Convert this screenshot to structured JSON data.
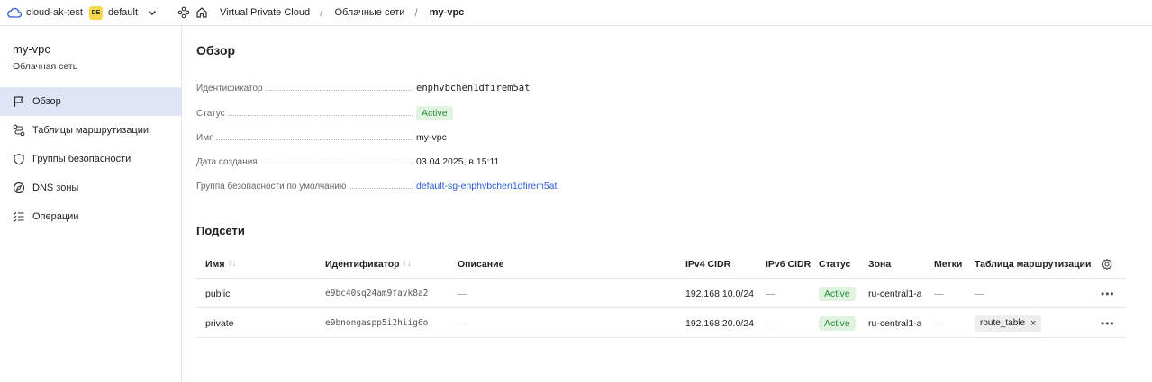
{
  "topbar": {
    "cloud_name": "cloud-ak-test",
    "folder_badge": "DE",
    "folder_name": "default",
    "breadcrumbs": [
      "Virtual Private Cloud",
      "Облачные сети",
      "my-vpc"
    ],
    "separator": "/"
  },
  "sidebar": {
    "title": "my-vpc",
    "subtitle": "Облачная сеть",
    "items": [
      {
        "label": "Обзор",
        "icon": "flag-icon",
        "active": true
      },
      {
        "label": "Таблицы маршрутизации",
        "icon": "route-icon"
      },
      {
        "label": "Группы безопасности",
        "icon": "shield-icon"
      },
      {
        "label": "DNS зоны",
        "icon": "compass-icon"
      },
      {
        "label": "Операции",
        "icon": "list-check-icon"
      }
    ]
  },
  "overview": {
    "title": "Обзор",
    "props": [
      {
        "label": "Идентификатор",
        "value": "enphvbchen1dfirem5at"
      },
      {
        "label": "Статус",
        "value": "Active"
      },
      {
        "label": "Имя",
        "value": "my-vpc"
      },
      {
        "label": "Дата создания",
        "value": "03.04.2025, в 15:11"
      },
      {
        "label": "Группа безопасности по умолчанию",
        "value": "default-sg-enphvbchen1dfirem5at"
      }
    ]
  },
  "subnets": {
    "title": "Подсети",
    "columns": [
      "Имя",
      "Идентификатор",
      "Описание",
      "IPv4 CIDR",
      "IPv6 CIDR",
      "Статус",
      "Зона",
      "Метки",
      "Таблица маршрутизации"
    ],
    "sort_glyph": "↑↓",
    "rows": [
      {
        "name": "public",
        "id": "e9bc40sq24am9favk8a2",
        "description": "—",
        "ipv4": "192.168.10.0/24",
        "ipv6": "—",
        "status": "Active",
        "zone": "ru-central1-a",
        "labels": "—",
        "route_table": "—"
      },
      {
        "name": "private",
        "id": "e9bnongaspp5i2hiig6o",
        "description": "—",
        "ipv4": "192.168.20.0/24",
        "ipv6": "—",
        "status": "Active",
        "zone": "ru-central1-a",
        "labels": "—",
        "route_table": "route_table"
      }
    ],
    "more_glyph": "•••",
    "tag_remove_glyph": "×"
  },
  "colors": {
    "accent": "#2b5cd6",
    "active_nav": "#dfe5f5",
    "status_bg": "#dff3e0",
    "status_text": "#2e8b3a",
    "folder_badge": "#f4d84b"
  }
}
